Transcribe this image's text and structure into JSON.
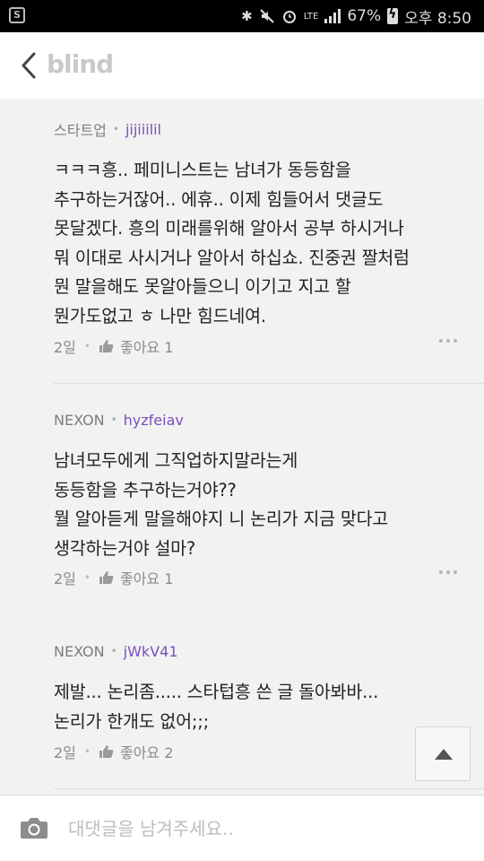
{
  "status_bar": {
    "network": "LTE",
    "battery": "67%",
    "time": "오후 8:50",
    "icons": [
      "sim-icon",
      "bluetooth-icon",
      "mute-icon",
      "alarm-icon",
      "lte-icon",
      "signal-icon",
      "battery-charging-icon"
    ]
  },
  "header": {
    "logo": "blind"
  },
  "comments": [
    {
      "company": "스타트업",
      "nickname": "jijiiilil",
      "body": "ㅋㅋㅋ흥.. 페미니스트는 남녀가 동등함을\n추구하는거잖어.. 에휴.. 이제 힘들어서 댓글도\n못달겠다. 흥의 미래를위해 알아서 공부 하시거나\n뭐 이대로 사시거나 알아서 하십쇼. 진중권 짤처럼\n뭔 말을해도 못알아들으니 이기고 지고 할\n뭔가도없고 ㅎ 나만 힘드네여.",
      "time": "2일",
      "like_label": "좋아요 1"
    },
    {
      "company": "NEXON",
      "nickname": "hyzfeiav",
      "body": "남녀모두에게 그직업하지말라는게\n동등함을 추구하는거야??\n뭘 알아듣게 말을해야지 니 논리가 지금 맞다고\n생각하는거야 설마?",
      "time": "2일",
      "like_label": "좋아요 1"
    },
    {
      "company": "NEXON",
      "nickname": "jWkV41",
      "body": "제발... 논리좀..... 스타텁흥 쓴 글 돌아봐바...\n논리가 한개도 없어;;;",
      "time": "2일",
      "like_label": "좋아요 2"
    }
  ],
  "reply_input": {
    "placeholder": "대댓글을 남겨주세요..",
    "value": ""
  },
  "colors": {
    "nickname": "#7a4fbf",
    "background": "#f2f2f2",
    "logo": "#c9c9c9"
  }
}
